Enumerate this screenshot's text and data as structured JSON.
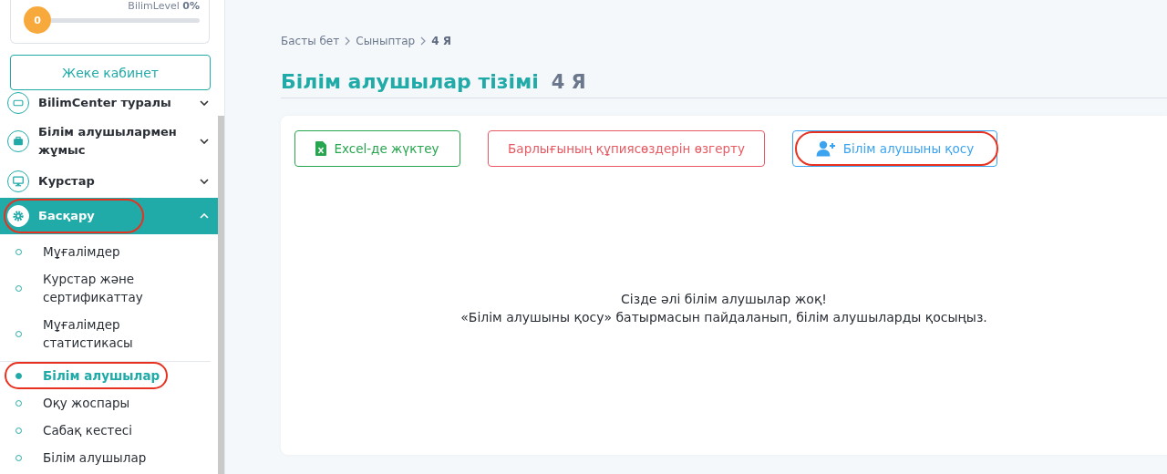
{
  "level_card": {
    "label": "BilimLevel",
    "percent": "0%",
    "badge": "0",
    "level": 0
  },
  "cabinet_button": "Жеке кабинет",
  "menu": [
    {
      "label": "BilimCenter туралы",
      "expanded": false,
      "selected": false,
      "highlighted": false
    },
    {
      "label": "Білім алушылармен жұмыс",
      "expanded": false,
      "selected": false,
      "highlighted": false
    },
    {
      "label": "Курстар",
      "expanded": false,
      "selected": false,
      "highlighted": false
    },
    {
      "label": "Басқару",
      "expanded": true,
      "selected": true,
      "highlighted": true,
      "children": [
        {
          "label": "Мұғалімдер",
          "selected": false,
          "highlighted": false,
          "divider_after": false
        },
        {
          "label": "Курстар және сертификаттау",
          "selected": false,
          "highlighted": false,
          "divider_after": false
        },
        {
          "label": "Мұғалімдер статистикасы",
          "selected": false,
          "highlighted": false,
          "divider_after": true
        },
        {
          "label": "Білім алушылар",
          "selected": true,
          "highlighted": true,
          "divider_after": false
        },
        {
          "label": "Оқу жоспары",
          "selected": false,
          "highlighted": false,
          "divider_after": false
        },
        {
          "label": "Сабақ кестесі",
          "selected": false,
          "highlighted": false,
          "divider_after": false
        },
        {
          "label": "Білім алушылар",
          "selected": false,
          "highlighted": false,
          "divider_after": false
        }
      ]
    }
  ],
  "breadcrumbs": [
    {
      "label": "Басты бет",
      "current": false
    },
    {
      "label": "Сыныптар",
      "current": false
    },
    {
      "label": "4 Я",
      "current": true
    }
  ],
  "title": "Білім алушылар тізімі",
  "subtitle": "4 Я",
  "buttons": [
    {
      "label": "Excel-де жүктеу",
      "kind": "excel",
      "highlighted": false
    },
    {
      "label": "Барлығының құпиясөздерін өзгерту",
      "kind": "danger",
      "highlighted": false
    },
    {
      "label": "Білім алушыны қосу",
      "kind": "add",
      "highlighted": true
    }
  ],
  "empty_message": [
    "Сізде әлі білім алушылар жоқ!",
    "«Білім алушыны қосу» батырмасын пайдаланып, білім алушыларды қосыңыз."
  ]
}
